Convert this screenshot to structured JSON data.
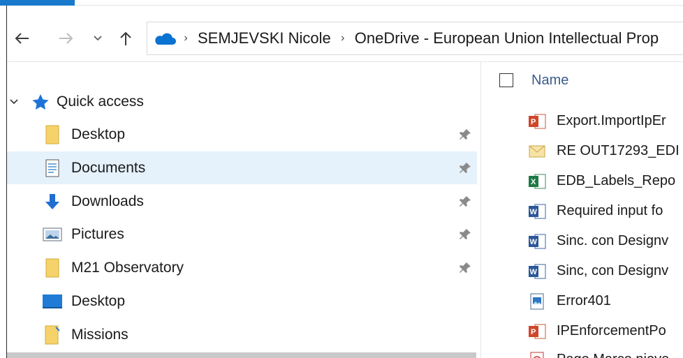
{
  "address_bar": {
    "crumbs": [
      "SEMJEVSKI Nicole",
      "OneDrive - European Union Intellectual Prop"
    ]
  },
  "nav_icons": {
    "back": "back-arrow-icon",
    "forward": "forward-arrow-icon",
    "recent": "chevron-down-icon",
    "up": "up-arrow-icon",
    "location": "onedrive-cloud-icon"
  },
  "tree": {
    "quick_access_label": "Quick access",
    "items": [
      {
        "label": "Desktop",
        "icon": "folder-icon",
        "pinned": true,
        "selected": false
      },
      {
        "label": "Documents",
        "icon": "documents-icon",
        "pinned": true,
        "selected": true
      },
      {
        "label": "Downloads",
        "icon": "downloads-icon",
        "pinned": true,
        "selected": false
      },
      {
        "label": "Pictures",
        "icon": "pictures-icon",
        "pinned": true,
        "selected": false
      },
      {
        "label": "M21 Observatory",
        "icon": "folder-icon",
        "pinned": true,
        "selected": false
      },
      {
        "label": "Desktop",
        "icon": "desktop-icon",
        "pinned": false,
        "selected": false
      },
      {
        "label": "Missions",
        "icon": "folder-icon",
        "pinned": false,
        "selected": false
      }
    ]
  },
  "file_list": {
    "name_header": "Name",
    "files": [
      {
        "name": "Export.ImportIpEr",
        "icon": "powerpoint-file-icon"
      },
      {
        "name": "RE OUT17293_EDI",
        "icon": "email-file-icon"
      },
      {
        "name": "EDB_Labels_Repo",
        "icon": "excel-file-icon"
      },
      {
        "name": "Required input fo",
        "icon": "word-file-icon"
      },
      {
        "name": "Sinc. con Designv",
        "icon": "word-file-icon"
      },
      {
        "name": "Sinc, con Designv",
        "icon": "word-file-icon"
      },
      {
        "name": "Error401",
        "icon": "image-file-icon"
      },
      {
        "name": "IPEnforcementPo",
        "icon": "powerpoint-file-icon"
      },
      {
        "name": "Pago Marco nieve",
        "icon": "pdf-file-icon"
      }
    ]
  },
  "colors": {
    "accent": "#1979ca",
    "selection": "#e5f1fb",
    "header_text": "#3a5c8a"
  }
}
